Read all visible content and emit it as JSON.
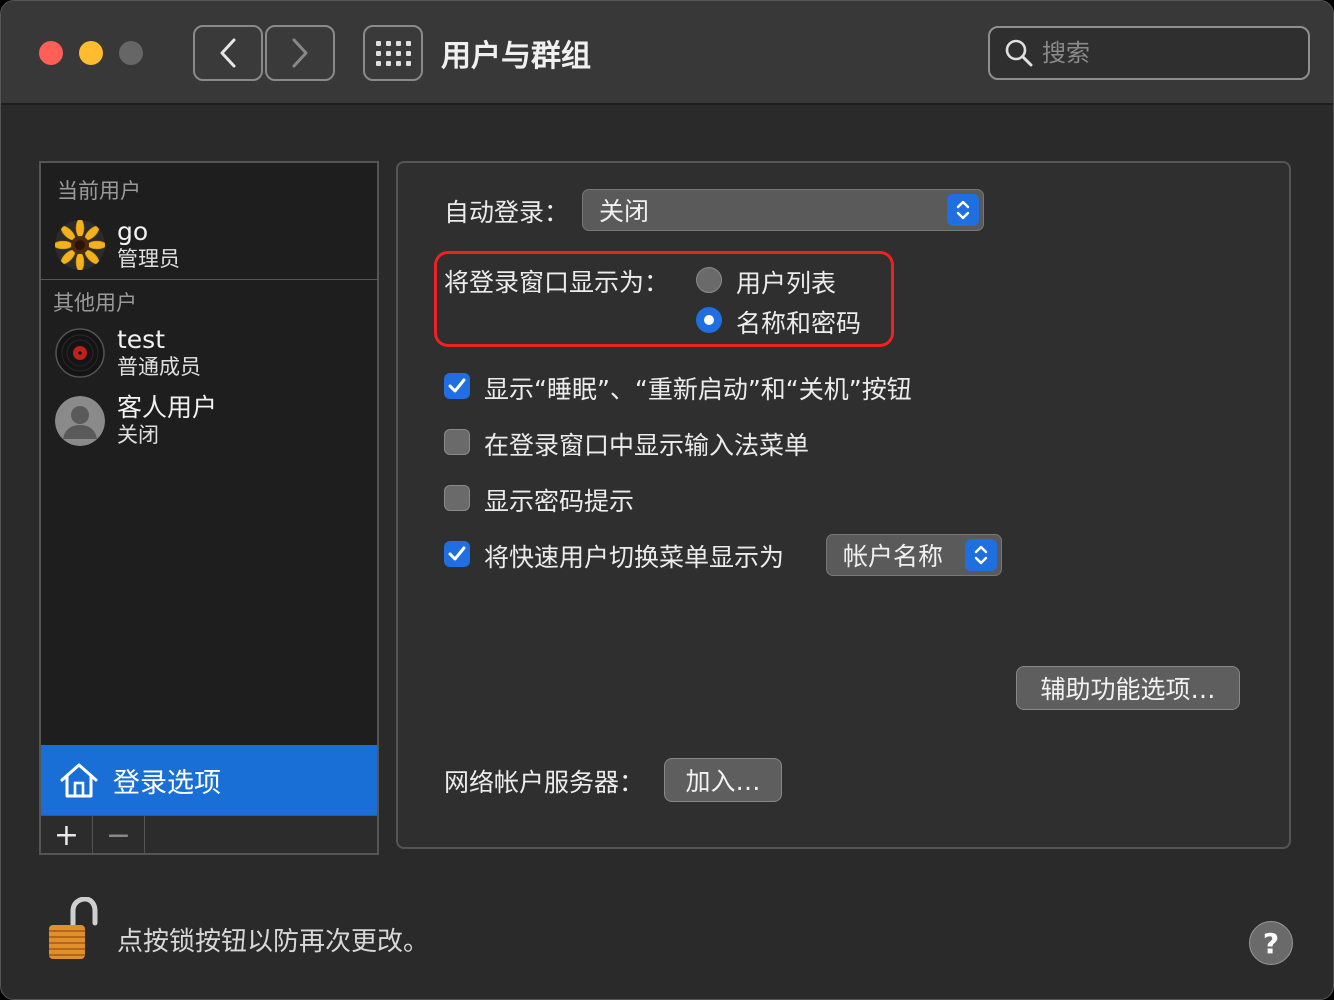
{
  "window": {
    "title": "用户与群组"
  },
  "search": {
    "placeholder": "搜索"
  },
  "sidebar": {
    "current_header": "当前用户",
    "other_header": "其他用户",
    "current_user": {
      "name": "go",
      "role": "管理员"
    },
    "other_users": [
      {
        "name": "test",
        "role": "普通成员"
      },
      {
        "name": "客人用户",
        "role": "关闭"
      }
    ],
    "login_options": "登录选项",
    "add_symbol": "+",
    "remove_symbol": "−"
  },
  "panel": {
    "auto_login_label": "自动登录：",
    "auto_login_value": "关闭",
    "display_as_label": "将登录窗口显示为：",
    "radio_user_list": "用户列表",
    "radio_name_password": "名称和密码",
    "radio_selected": "名称和密码",
    "checkboxes": [
      {
        "label": "显示“睡眠”、“重新启动”和“关机”按钮",
        "checked": true
      },
      {
        "label": "在登录窗口中显示输入法菜单",
        "checked": false
      },
      {
        "label": "显示密码提示",
        "checked": false
      },
      {
        "label": "将快速用户切换菜单显示为",
        "checked": true
      }
    ],
    "fast_switch_value": "帐户名称",
    "accessibility_button": "辅助功能选项…",
    "network_server_label": "网络帐户服务器：",
    "join_button": "加入…"
  },
  "footer": {
    "lock_text": "点按锁按钮以防再次更改。",
    "help_symbol": "?"
  },
  "colors": {
    "accent": "#1f6fe0",
    "selection": "#1a6fd6",
    "highlight_box": "#ee2222"
  }
}
